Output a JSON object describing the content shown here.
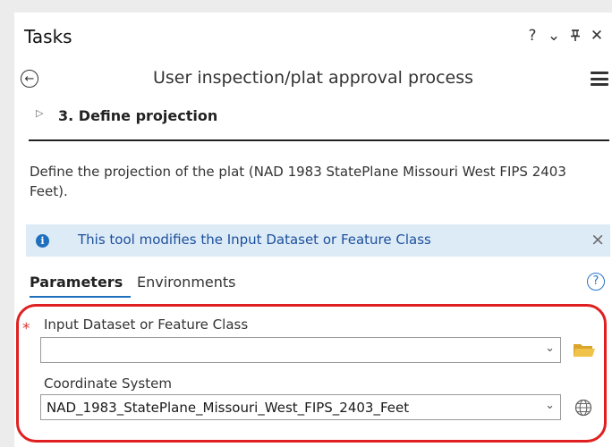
{
  "pane": {
    "title": "Tasks",
    "buttons": {
      "help": "?",
      "options": "⌄",
      "pin": "ᛘ",
      "close": "✕"
    }
  },
  "nav": {
    "back_glyph": "←",
    "task_title": "User inspection/plat approval process"
  },
  "step": {
    "expander": "▷",
    "title": "3.  Define projection"
  },
  "description": "Define the projection of the plat (NAD 1983 StatePlane Missouri West FIPS 2403 Feet).",
  "info_banner": {
    "icon_glyph": "i",
    "text": "This tool modifies the Input Dataset or Feature Class",
    "close_glyph": "×"
  },
  "tabs": {
    "parameters": "Parameters",
    "environments": "Environments",
    "help_glyph": "?"
  },
  "params": {
    "input_dataset": {
      "required_marker": "*",
      "label": "Input Dataset or Feature Class",
      "value": "",
      "arrow": "⌄"
    },
    "coordinate_system": {
      "label": "Coordinate System",
      "value": "NAD_1983_StatePlane_Missouri_West_FIPS_2403_Feet",
      "arrow": "⌄"
    }
  },
  "colors": {
    "highlight_border": "#e02020",
    "info_bg": "#ddebf7",
    "info_text": "#1c4f9c",
    "accent": "#1f6fbf",
    "folder": "#e8b93a"
  },
  "icons": [
    "back-icon",
    "menu-icon",
    "info-icon",
    "help-icon",
    "folder-icon",
    "globe-icon",
    "close-icon",
    "pin-icon"
  ]
}
